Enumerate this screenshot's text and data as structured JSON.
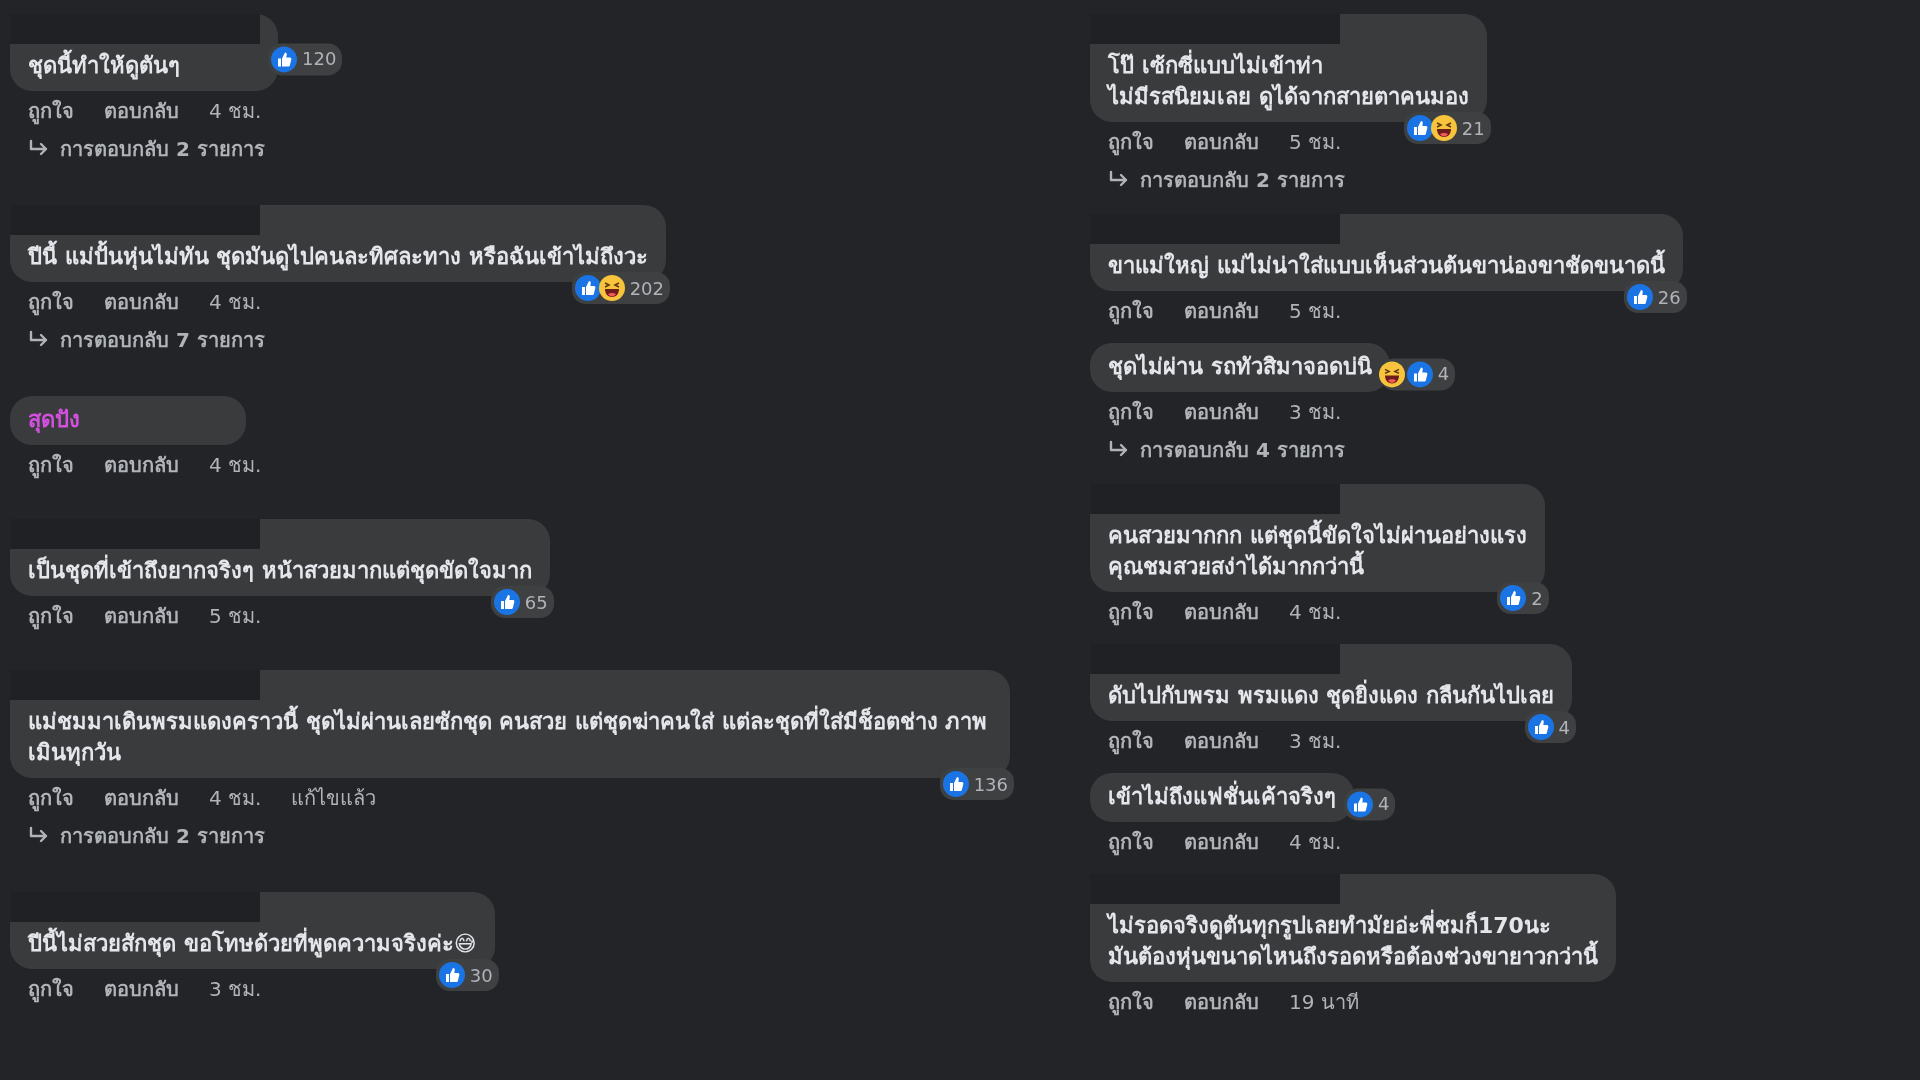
{
  "columns": [
    {
      "comments": [
        {
          "redacted": true,
          "text": "ชุดนี้ทำให้ดูตันๆ",
          "reactions": {
            "kind": "inline",
            "icons": [
              {
                "kind": "like"
              }
            ],
            "count": "120"
          },
          "actions": [
            "ถูกใจ",
            "ตอบกลับ"
          ],
          "time": "4 ชม.",
          "replies": "การตอบกลับ 2 รายการ"
        },
        {
          "redacted": true,
          "text": "ปีนี้ แม่ปั้นหุ่นไม่ทัน ชุดมันดูไปคนละทิศละทาง หรือฉันเข้าไม่ถึงวะ",
          "reactions": {
            "kind": "corner",
            "icons": [
              {
                "kind": "like"
              },
              {
                "kind": "haha"
              }
            ],
            "count": "202"
          },
          "actions": [
            "ถูกใจ",
            "ตอบกลับ"
          ],
          "time": "4 ชม.",
          "replies": "การตอบกลับ 7 รายการ"
        },
        {
          "redacted": false,
          "text": "สุดปัง",
          "color": "#d34fe0",
          "actions": [
            "ถูกใจ",
            "ตอบกลับ"
          ],
          "time": "4 ชม."
        },
        {
          "redacted": true,
          "text": "เป็นชุดที่เข้าถึงยากจริงๆ หน้าสวยมากแต่ชุดขัดใจมาก",
          "reactions": {
            "kind": "corner",
            "icons": [
              {
                "kind": "like"
              }
            ],
            "count": "65"
          },
          "actions": [
            "ถูกใจ",
            "ตอบกลับ"
          ],
          "time": "5 ชม."
        },
        {
          "redacted": true,
          "text": "แม่ชมมาเดินพรมแดงคราวนี้ ชุดไม่ผ่านเลยซักชุด คนสวย แต่ชุดฆ่าคนใส่ แต่ละชุดที่ใส่มีช็อตช่าง ภาพเมินทุกวัน",
          "reactions": {
            "kind": "corner",
            "icons": [
              {
                "kind": "like"
              }
            ],
            "count": "136"
          },
          "actions": [
            "ถูกใจ",
            "ตอบกลับ"
          ],
          "time": "4 ชม.",
          "edited": "แก้ไขแล้ว",
          "replies": "การตอบกลับ 2 รายการ"
        },
        {
          "redacted": true,
          "text": "ปีนี้ไม่สวยสักชุด ขอโทษด้วยที่พูดความจริงค่ะ😅",
          "reactions": {
            "kind": "corner",
            "icons": [
              {
                "kind": "like"
              }
            ],
            "count": "30"
          },
          "actions": [
            "ถูกใจ",
            "ตอบกลับ"
          ],
          "time": "3 ชม."
        }
      ]
    },
    {
      "comments": [
        {
          "redacted": true,
          "text": "โป๊ เซ้กซี่แบบไม่เข้าท่า\nไม่มีรสนิยมเลย ดูได้จากสายตาคนมอง",
          "reactions": {
            "kind": "corner",
            "icons": [
              {
                "kind": "like"
              },
              {
                "kind": "haha"
              }
            ],
            "count": "21"
          },
          "actions": [
            "ถูกใจ",
            "ตอบกลับ"
          ],
          "time": "5 ชม.",
          "replies": "การตอบกลับ 2 รายการ"
        },
        {
          "redacted": true,
          "text": "ขาแม่ใหญ่ แม่ไม่น่าใส่แบบเห็นส่วนต้นขาน่องขาชัดขนาดนี้",
          "reactions": {
            "kind": "corner",
            "icons": [
              {
                "kind": "like"
              }
            ],
            "count": "26"
          },
          "actions": [
            "ถูกใจ",
            "ตอบกลับ"
          ],
          "time": "5 ชม."
        },
        {
          "redacted": false,
          "text": "ชุดไม่ผ่าน รถทัวสิมาจอดบ่นิ",
          "reactions": {
            "kind": "inline",
            "icons": [
              {
                "kind": "haha"
              },
              {
                "kind": "like"
              }
            ],
            "count": "4"
          },
          "actions": [
            "ถูกใจ",
            "ตอบกลับ"
          ],
          "time": "3 ชม.",
          "replies": "การตอบกลับ 4 รายการ"
        },
        {
          "redacted": true,
          "text": "คนสวยมากกก แต่ชุดนี้ขัดใจไม่ผ่านอย่างแรง\nคุณชมสวยสง่าได้มากกว่านี้",
          "reactions": {
            "kind": "corner",
            "icons": [
              {
                "kind": "like"
              }
            ],
            "count": "2"
          },
          "actions": [
            "ถูกใจ",
            "ตอบกลับ"
          ],
          "time": "4 ชม."
        },
        {
          "redacted": true,
          "text": "ดับไปกับพรม พรมแดง ชุดยิ่งแดง กลืนกันไปเลย",
          "reactions": {
            "kind": "corner",
            "icons": [
              {
                "kind": "like"
              }
            ],
            "count": "4"
          },
          "actions": [
            "ถูกใจ",
            "ตอบกลับ"
          ],
          "time": "3 ชม."
        },
        {
          "redacted": false,
          "text": "เข้าไม่ถึงแฟชั่นเค้าจริงๆ",
          "reactions": {
            "kind": "inline",
            "icons": [
              {
                "kind": "like"
              }
            ],
            "count": "4"
          },
          "actions": [
            "ถูกใจ",
            "ตอบกลับ"
          ],
          "time": "4 ชม."
        },
        {
          "redacted": true,
          "text": "ไม่รอดจริงดูตันทุกรูปเลยทำมัยอ่ะพี่ชมก็170นะ\nมันต้องหุ่นขนาดไหนถึงรอดหรือต้องช่วงขายาวกว่านี้",
          "actions": [
            "ถูกใจ",
            "ตอบกลับ"
          ],
          "time": "19 นาที"
        }
      ]
    }
  ]
}
